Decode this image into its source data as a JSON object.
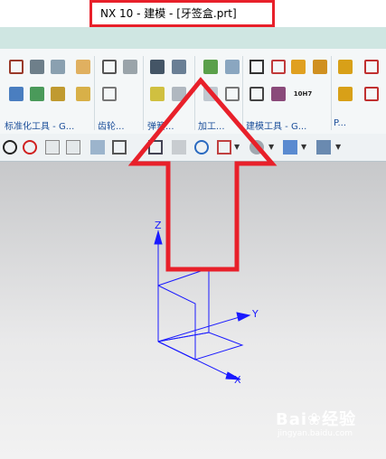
{
  "window": {
    "title": "NX 10 - 建模 - [牙签盒.prt]"
  },
  "ribbon": {
    "groups": [
      {
        "label": "标准化工具 - G..."
      },
      {
        "label": "齿轮..."
      },
      {
        "label": "弹簧..."
      },
      {
        "label": "加工..."
      },
      {
        "label": "建模工具 - G..."
      },
      {
        "label": "P..."
      }
    ],
    "icon_10h7": "10H7"
  },
  "axes": {
    "z_label": "Z",
    "y_label": "Y",
    "x_label": "X",
    "color": "#1a1aff"
  },
  "overlay": {
    "highlight_color": "#e8202a"
  },
  "watermark": {
    "brand": "Bai",
    "brand_tail": "经验",
    "url": "jingyan.baidu.com"
  }
}
